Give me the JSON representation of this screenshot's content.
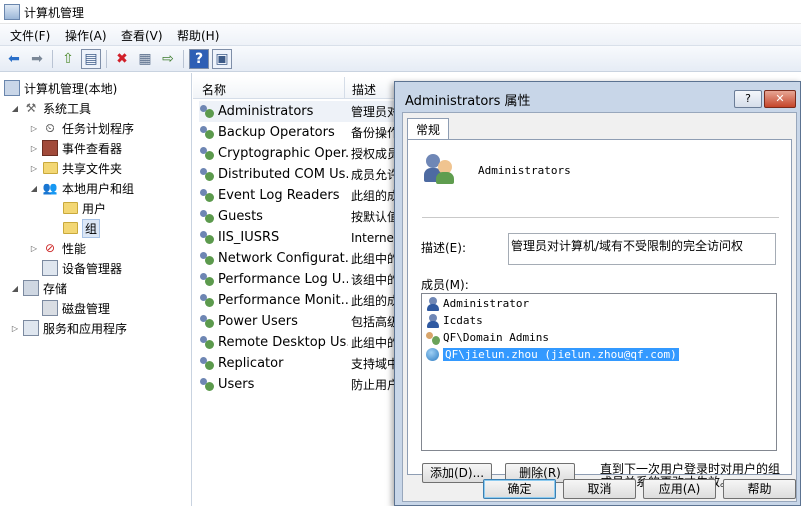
{
  "window": {
    "title": "计算机管理"
  },
  "menu": [
    "文件(F)",
    "操作(A)",
    "查看(V)",
    "帮助(H)"
  ],
  "toolbar": {
    "icons": [
      "back-arrow-icon",
      "forward-arrow-icon",
      "up-folder-icon",
      "show-tree-icon",
      "delete-icon",
      "properties-icon",
      "export-list-icon",
      "help-icon",
      "show-action-pane-icon"
    ],
    "glyphs": {
      "back": "⬅",
      "forward": "➡",
      "up": "⇧",
      "tree": "▤",
      "delete": "✖",
      "props": "▦",
      "export": "⇨",
      "help": "?",
      "pane": "▣"
    }
  },
  "tree": {
    "items": [
      {
        "label": "计算机管理(本地)",
        "twisty": ""
      },
      {
        "label": "系统工具",
        "twisty": "◢"
      },
      {
        "label": "任务计划程序",
        "twisty": "▷"
      },
      {
        "label": "事件查看器",
        "twisty": "▷"
      },
      {
        "label": "共享文件夹",
        "twisty": "▷"
      },
      {
        "label": "本地用户和组",
        "twisty": "◢"
      },
      {
        "label": "用户",
        "twisty": ""
      },
      {
        "label": "组",
        "twisty": ""
      },
      {
        "label": "性能",
        "twisty": "▷"
      },
      {
        "label": "设备管理器",
        "twisty": ""
      },
      {
        "label": "存储",
        "twisty": "◢"
      },
      {
        "label": "磁盘管理",
        "twisty": ""
      },
      {
        "label": "服务和应用程序",
        "twisty": "▷"
      }
    ]
  },
  "list": {
    "columns": [
      "名称",
      "描述"
    ],
    "rows": [
      {
        "name": "Administrators",
        "desc": "管理员对"
      },
      {
        "name": "Backup Operators",
        "desc": "备份操作"
      },
      {
        "name": "Cryptographic Oper...",
        "desc": "授权成员"
      },
      {
        "name": "Distributed COM Us...",
        "desc": "成员允许"
      },
      {
        "name": "Event Log Readers",
        "desc": "此组的成"
      },
      {
        "name": "Guests",
        "desc": "按默认值"
      },
      {
        "name": "IIS_IUSRS",
        "desc": "Interne"
      },
      {
        "name": "Network Configurat...",
        "desc": "此组中的"
      },
      {
        "name": "Performance Log U...",
        "desc": "该组中的"
      },
      {
        "name": "Performance Monit...",
        "desc": "此组的成"
      },
      {
        "name": "Power Users",
        "desc": "包括高级"
      },
      {
        "name": "Remote Desktop Us...",
        "desc": "此组中的"
      },
      {
        "name": "Replicator",
        "desc": "支持域中"
      },
      {
        "name": "Users",
        "desc": "防止用户"
      }
    ]
  },
  "dialog": {
    "title": "Administrators 属性",
    "help_button": "?",
    "close_button": "✕",
    "tab": "常规",
    "group_name": "Administrators",
    "description_label": "描述(E):",
    "description_value": "管理员对计算机/域有不受限制的完全访问权",
    "members_label": "成员(M):",
    "members": [
      {
        "name": "Administrator",
        "icon": "user-icon"
      },
      {
        "name": "Icdats",
        "icon": "user-icon"
      },
      {
        "name": "QF\\Domain Admins",
        "icon": "group-icon"
      },
      {
        "name": "QF\\jielun.zhou (jielun.zhou@qf.com)",
        "icon": "domain-user-icon"
      }
    ],
    "add_button": "添加(D)...",
    "remove_button": "删除(R)",
    "note": "直到下一次用户登录时对用户的组成员关系的更改才生效。",
    "ok_button": "确定",
    "cancel_button": "取消",
    "apply_button": "应用(A)",
    "help_text_button": "帮助"
  }
}
